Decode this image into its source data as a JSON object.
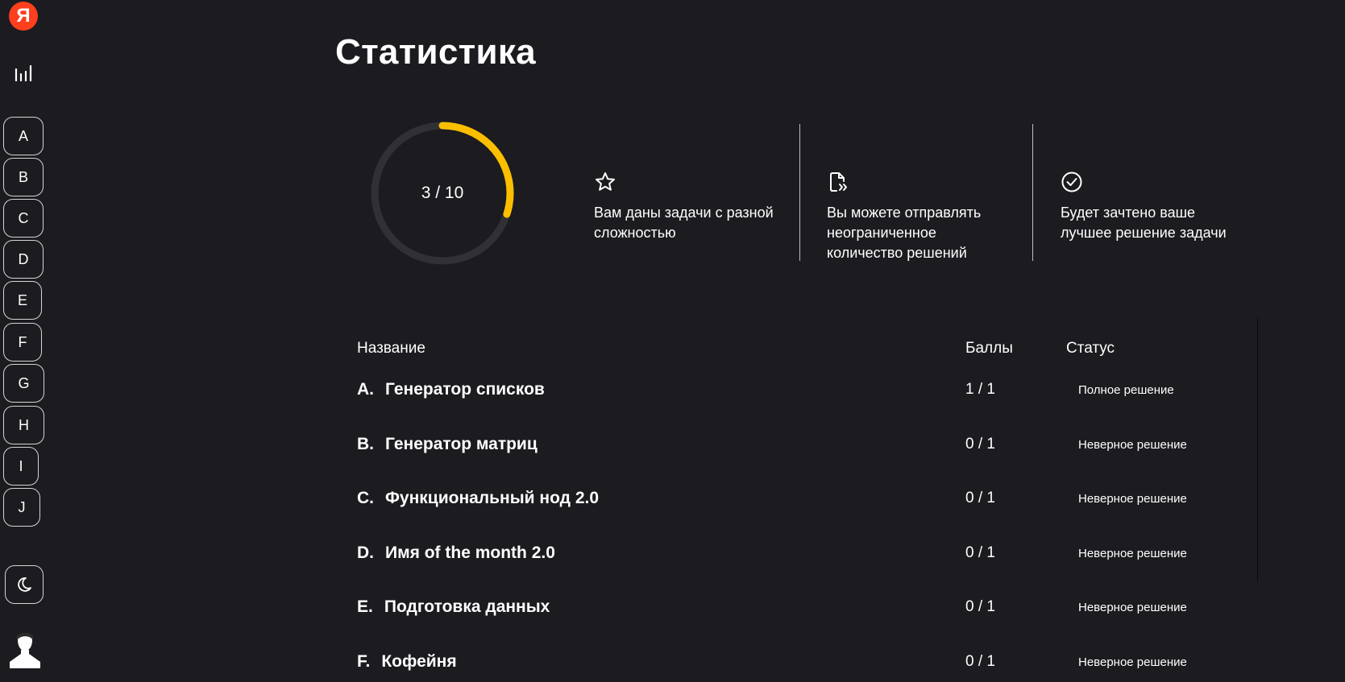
{
  "sidebar": {
    "logo_text": "Я",
    "logo_color": "#fc3f1d",
    "stats_icon": "bar-chart-icon",
    "tasks": [
      "A",
      "B",
      "C",
      "D",
      "E",
      "F",
      "G",
      "H",
      "I",
      "J"
    ],
    "theme_icon": "moon-icon",
    "avatar_icon": "user-avatar-icon"
  },
  "main": {
    "title": "Статистика",
    "progress": {
      "solved": 3,
      "total": 10,
      "label": "3 / 10",
      "color": "#fbbf00",
      "track_color": "#313135"
    },
    "info": [
      {
        "icon": "star-icon",
        "text": "Вам даны задачи с разной сложностью"
      },
      {
        "icon": "file-send-icon",
        "text": "Вы можете отправлять неограниченное количество решений"
      },
      {
        "icon": "check-circle-icon",
        "text": "Будет зачтено ваше лучшее решение задачи"
      }
    ]
  },
  "table": {
    "headers": {
      "name": "Название",
      "score": "Баллы",
      "status": "Статус"
    },
    "rows": [
      {
        "letter": "A.",
        "name": "Генератор списков",
        "score": "1 / 1",
        "status": "Полное решение"
      },
      {
        "letter": "B.",
        "name": "Генератор матриц",
        "score": "0 / 1",
        "status": "Неверное решение"
      },
      {
        "letter": "C.",
        "name": "Функциональный нод 2.0",
        "score": "0 / 1",
        "status": "Неверное решение"
      },
      {
        "letter": "D.",
        "name": "Имя of the month 2.0",
        "score": "0 / 1",
        "status": "Неверное решение"
      },
      {
        "letter": "E.",
        "name": "Подготовка данных",
        "score": "0 / 1",
        "status": "Неверное решение"
      },
      {
        "letter": "F.",
        "name": "Кофейня",
        "score": "0 / 1",
        "status": "Неверное решение"
      }
    ]
  }
}
